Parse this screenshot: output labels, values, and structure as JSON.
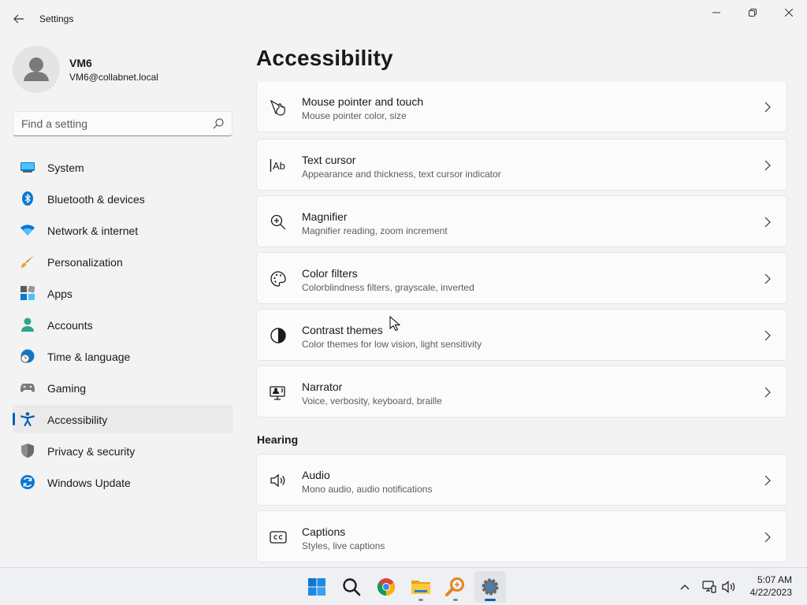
{
  "window": {
    "title": "Settings"
  },
  "user": {
    "name": "VM6",
    "email": "VM6@collabnet.local"
  },
  "search": {
    "placeholder": "Find a setting",
    "value": ""
  },
  "sidebar": {
    "items": [
      {
        "label": "System",
        "icon": "system-icon"
      },
      {
        "label": "Bluetooth & devices",
        "icon": "bluetooth-icon"
      },
      {
        "label": "Network & internet",
        "icon": "wifi-icon"
      },
      {
        "label": "Personalization",
        "icon": "brush-icon"
      },
      {
        "label": "Apps",
        "icon": "apps-icon"
      },
      {
        "label": "Accounts",
        "icon": "person-icon"
      },
      {
        "label": "Time & language",
        "icon": "globe-clock-icon"
      },
      {
        "label": "Gaming",
        "icon": "gamepad-icon"
      },
      {
        "label": "Accessibility",
        "icon": "accessibility-icon",
        "selected": true
      },
      {
        "label": "Privacy & security",
        "icon": "shield-icon"
      },
      {
        "label": "Windows Update",
        "icon": "update-icon"
      }
    ]
  },
  "main": {
    "title": "Accessibility",
    "vision_cards": [
      {
        "title": "Mouse pointer and touch",
        "subtitle": "Mouse pointer color, size",
        "icon": "mouse-pointer-icon"
      },
      {
        "title": "Text cursor",
        "subtitle": "Appearance and thickness, text cursor indicator",
        "icon": "text-cursor-icon"
      },
      {
        "title": "Magnifier",
        "subtitle": "Magnifier reading, zoom increment",
        "icon": "magnifier-icon"
      },
      {
        "title": "Color filters",
        "subtitle": "Colorblindness filters, grayscale, inverted",
        "icon": "palette-icon"
      },
      {
        "title": "Contrast themes",
        "subtitle": "Color themes for low vision, light sensitivity",
        "icon": "contrast-icon"
      },
      {
        "title": "Narrator",
        "subtitle": "Voice, verbosity, keyboard, braille",
        "icon": "narrator-icon"
      }
    ],
    "hearing_heading": "Hearing",
    "hearing_cards": [
      {
        "title": "Audio",
        "subtitle": "Mono audio, audio notifications",
        "icon": "speaker-icon"
      },
      {
        "title": "Captions",
        "subtitle": "Styles, live captions",
        "icon": "captions-icon"
      }
    ]
  },
  "taskbar": {
    "apps": [
      "start-icon",
      "search-icon",
      "chrome-icon",
      "file-explorer-icon",
      "magnifier-app-icon",
      "settings-icon"
    ],
    "tray": [
      "chevron-up-icon",
      "network-icon",
      "volume-icon"
    ],
    "time": "5:07 AM",
    "date": "4/22/2023"
  },
  "colors": {
    "accent": "#005fb8",
    "background": "#f3f3f3",
    "card": "#fbfbfb"
  }
}
